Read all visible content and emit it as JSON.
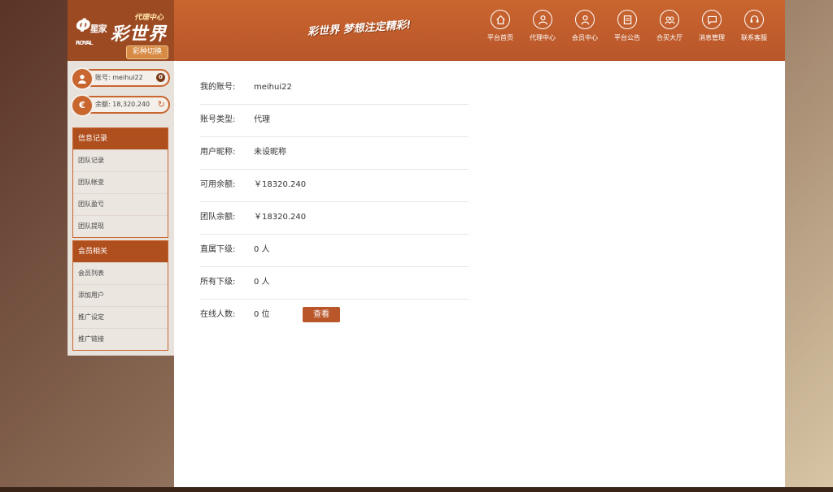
{
  "header": {
    "logo_royal": "ROYAL",
    "logo_brand": "星家",
    "logo_agent": "代理中心",
    "logo_main": "彩世界",
    "lottery_switch": "彩种切换",
    "slogan": "彩世界 梦想注定精彩!",
    "nav": [
      {
        "label": "平台首页",
        "icon": "home-icon"
      },
      {
        "label": "代理中心",
        "icon": "agent-icon"
      },
      {
        "label": "会员中心",
        "icon": "member-icon"
      },
      {
        "label": "平台公告",
        "icon": "notice-icon"
      },
      {
        "label": "合买大厅",
        "icon": "group-buy-icon"
      },
      {
        "label": "消息管理",
        "icon": "message-icon"
      },
      {
        "label": "联系客服",
        "icon": "support-icon"
      }
    ]
  },
  "sidebar": {
    "account": {
      "label": "账号:",
      "value": "meihui22",
      "badge": "0"
    },
    "balance": {
      "label": "余额:",
      "value": "18,320.240"
    },
    "groups": [
      {
        "title": "信息记录",
        "items": [
          "团队记录",
          "团队帐变",
          "团队盈亏",
          "团队提现"
        ]
      },
      {
        "title": "会员相关",
        "items": [
          "会员列表",
          "添加用户",
          "推广设定",
          "推广链接"
        ]
      }
    ]
  },
  "info": {
    "rows": [
      {
        "label": "我的账号:",
        "value": "meihui22"
      },
      {
        "label": "账号类型:",
        "value": "代理"
      },
      {
        "label": "用户昵称:",
        "value": "未设昵称"
      },
      {
        "label": "可用余额:",
        "value": "￥18320.240"
      },
      {
        "label": "团队余额:",
        "value": "￥18320.240"
      },
      {
        "label": "直属下级:",
        "value": "0 人"
      },
      {
        "label": "所有下级:",
        "value": "0 人"
      },
      {
        "label": "在线人数:",
        "value": "0 位"
      }
    ],
    "view_button": "查看"
  },
  "colors": {
    "brand": "#c9652f",
    "brand_dark": "#b04f1e"
  }
}
